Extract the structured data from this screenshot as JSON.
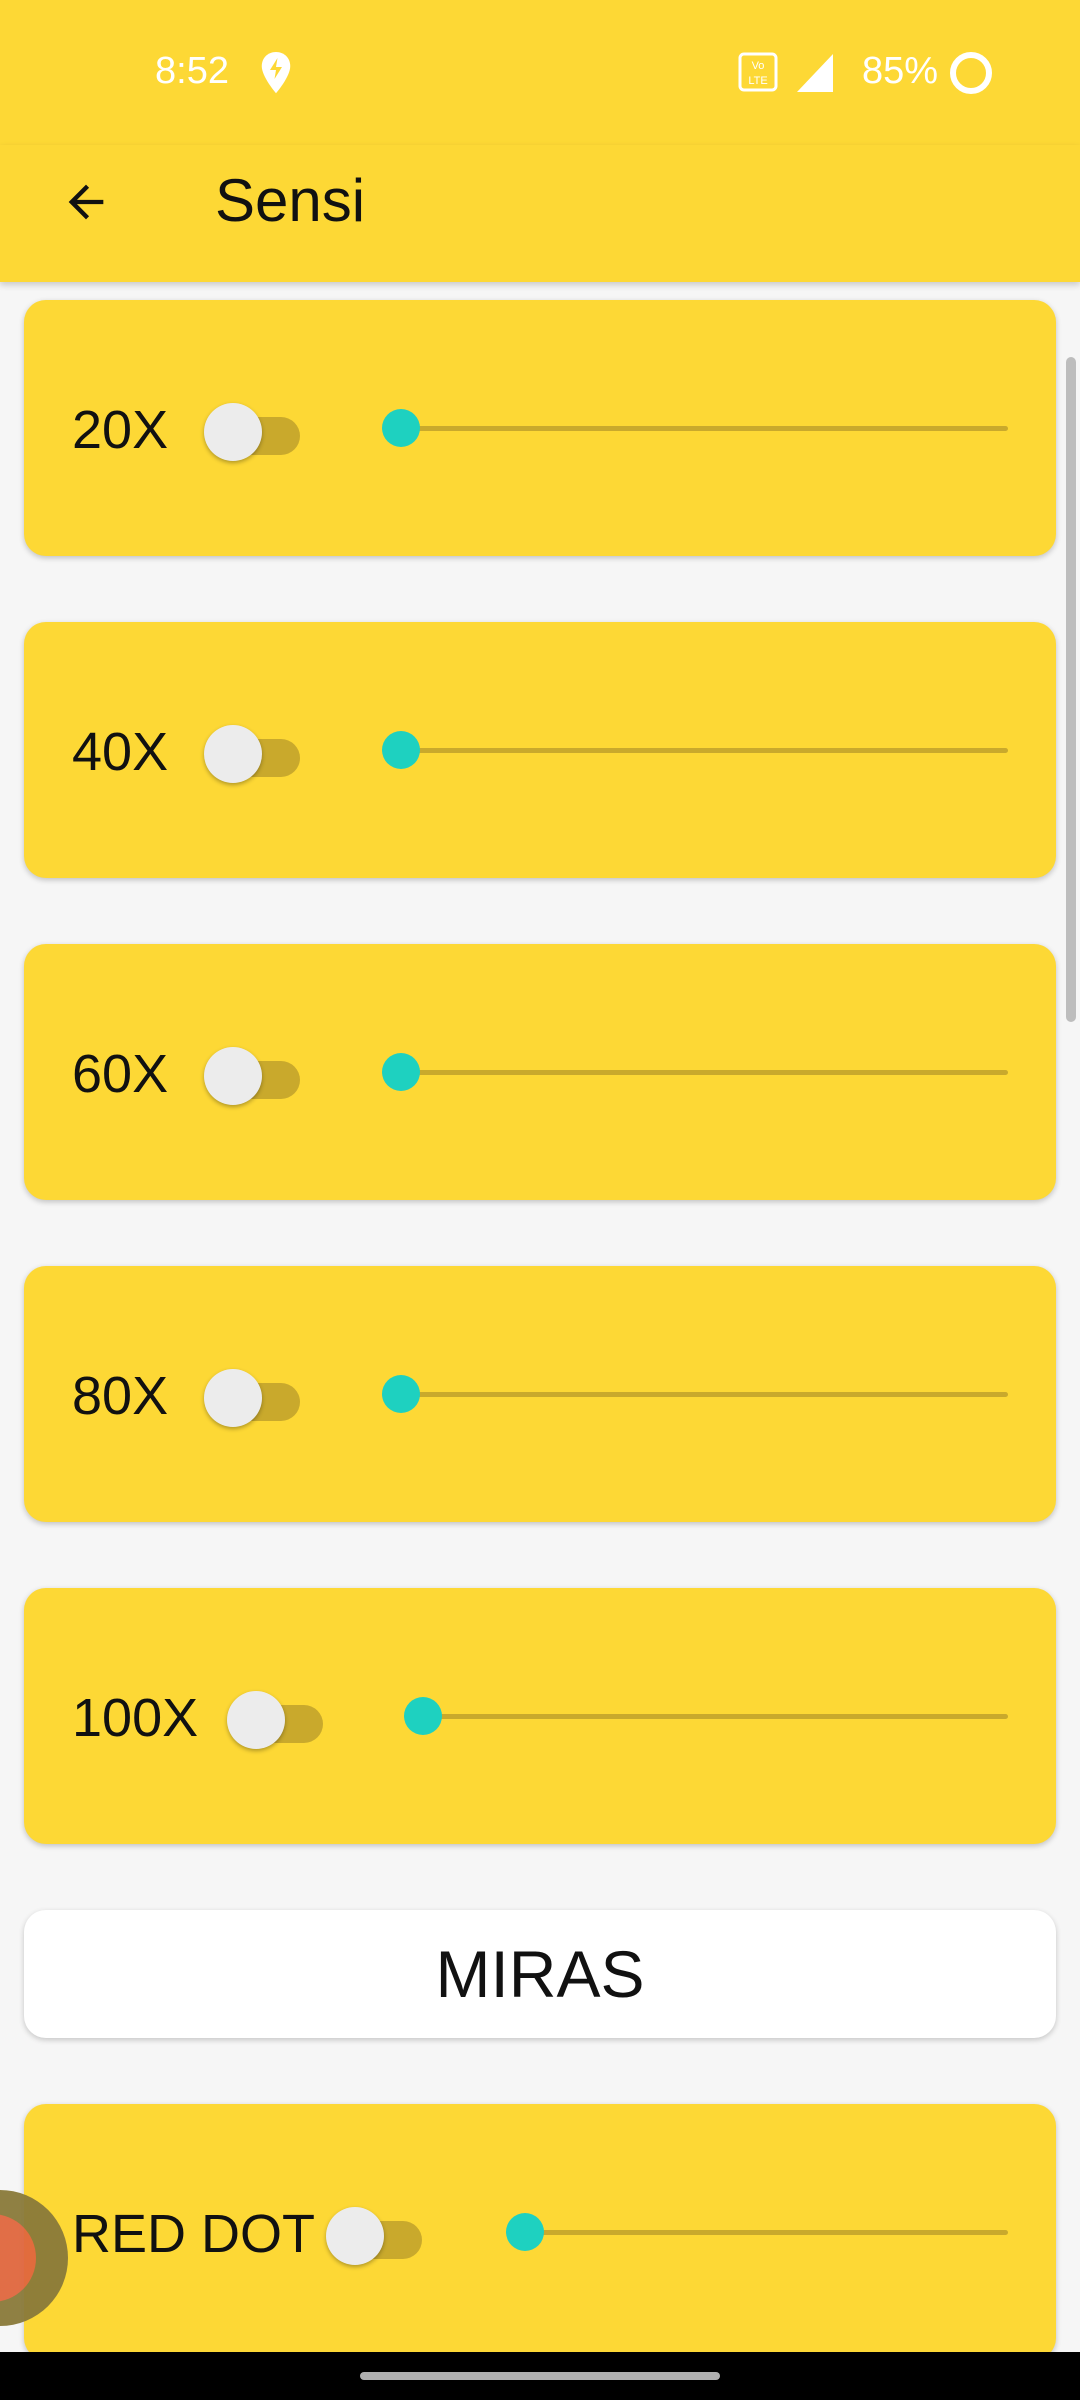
{
  "status_bar": {
    "time": "8:52",
    "battery_percent": "85%",
    "icons": [
      "location-pin-icon",
      "volte-icon",
      "signal-icon",
      "battery-ring-icon"
    ]
  },
  "app_bar": {
    "title": "Sensi",
    "back_icon": "arrow-left-icon"
  },
  "scope_items": [
    {
      "label": "20X",
      "toggle_on": false,
      "slider_value": 0
    },
    {
      "label": "40X",
      "toggle_on": false,
      "slider_value": 0
    },
    {
      "label": "60X",
      "toggle_on": false,
      "slider_value": 0
    },
    {
      "label": "80X",
      "toggle_on": false,
      "slider_value": 0
    },
    {
      "label": "100X",
      "toggle_on": false,
      "slider_value": 0
    }
  ],
  "section_header": "MIRAS",
  "sight_items": [
    {
      "label": "RED DOT",
      "toggle_on": false,
      "slider_value": 0
    }
  ],
  "colors": {
    "accent": "#fdd835",
    "slider_knob": "#1ed1c0",
    "track": "#c9a92c",
    "background": "#f6f6f6"
  }
}
